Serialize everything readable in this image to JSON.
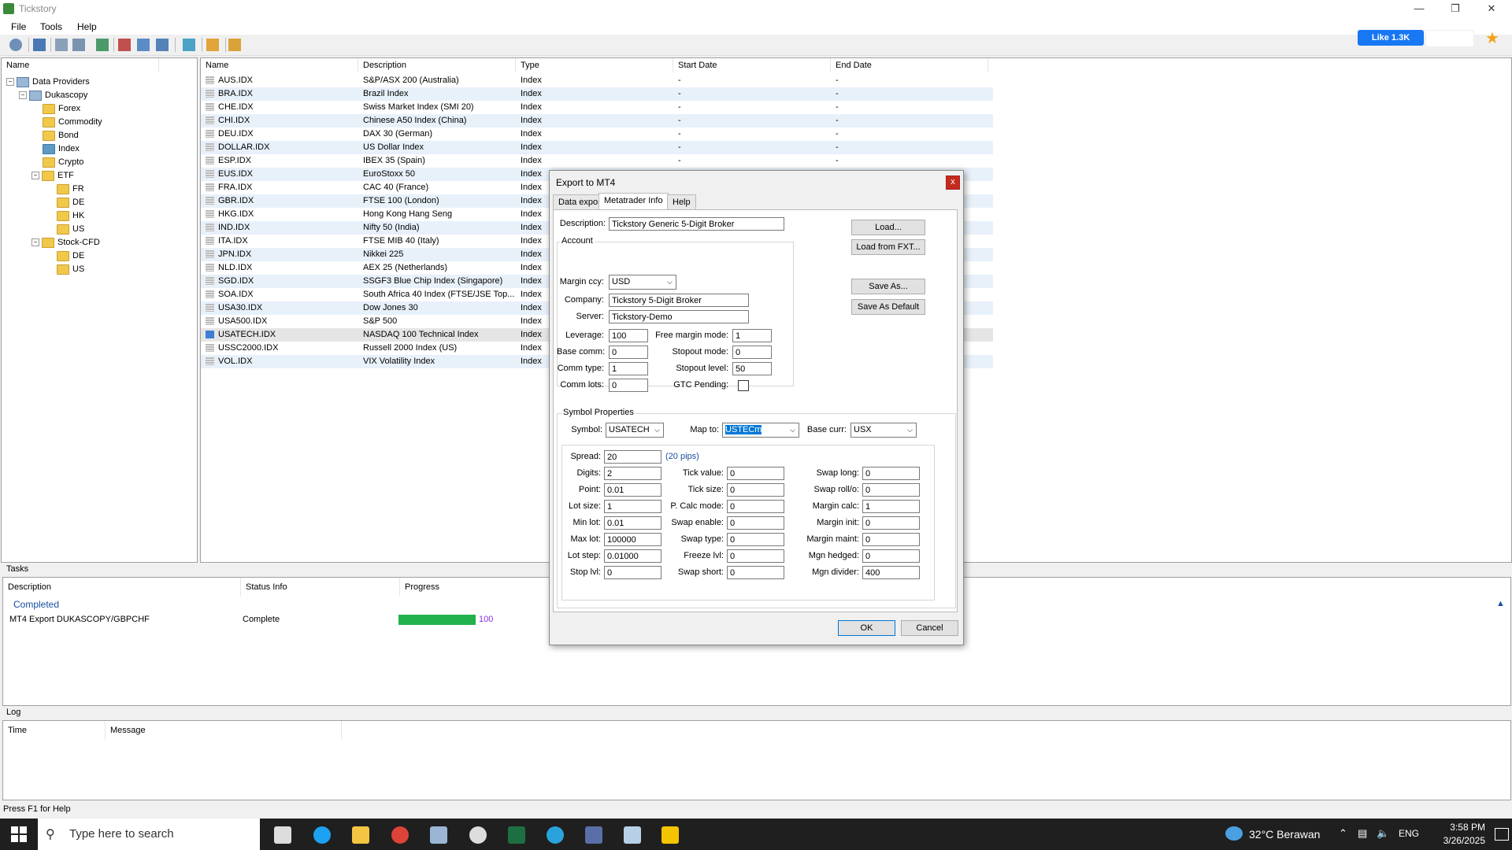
{
  "app": {
    "title": "Tickstory"
  },
  "menu": {
    "file": "File",
    "tools": "Tools",
    "help": "Help"
  },
  "social": {
    "like_label": "Like 1.3K"
  },
  "tree": {
    "header": "Name",
    "nodes": [
      {
        "label": "Data Providers",
        "level": 0
      },
      {
        "label": "Dukascopy",
        "level": 1
      },
      {
        "label": "Forex",
        "level": 2
      },
      {
        "label": "Commodity",
        "level": 2
      },
      {
        "label": "Bond",
        "level": 2
      },
      {
        "label": "Index",
        "level": 2
      },
      {
        "label": "Crypto",
        "level": 2
      },
      {
        "label": "ETF",
        "level": 2
      },
      {
        "label": "FR",
        "level": 3
      },
      {
        "label": "DE",
        "level": 3
      },
      {
        "label": "HK",
        "level": 3
      },
      {
        "label": "US",
        "level": 3
      },
      {
        "label": "Stock-CFD",
        "level": 2
      },
      {
        "label": "DE",
        "level": 3
      },
      {
        "label": "US",
        "level": 3
      }
    ]
  },
  "symbols": {
    "columns": [
      "Name",
      "Description",
      "Type",
      "Start Date",
      "End Date"
    ],
    "rows": [
      [
        "AUS.IDX",
        "S&P/ASX 200 (Australia)",
        "Index",
        "-",
        "-"
      ],
      [
        "BRA.IDX",
        "Brazil Index",
        "Index",
        "-",
        "-"
      ],
      [
        "CHE.IDX",
        "Swiss Market Index (SMI 20)",
        "Index",
        "-",
        "-"
      ],
      [
        "CHI.IDX",
        "Chinese A50 Index (China)",
        "Index",
        "-",
        "-"
      ],
      [
        "DEU.IDX",
        "DAX 30 (German)",
        "Index",
        "-",
        "-"
      ],
      [
        "DOLLAR.IDX",
        "US Dollar Index",
        "Index",
        "-",
        "-"
      ],
      [
        "ESP.IDX",
        "IBEX 35 (Spain)",
        "Index",
        "-",
        "-"
      ],
      [
        "EUS.IDX",
        "EuroStoxx 50",
        "Index",
        "",
        ""
      ],
      [
        "FRA.IDX",
        "CAC 40 (France)",
        "Index",
        "",
        ""
      ],
      [
        "GBR.IDX",
        "FTSE 100 (London)",
        "Index",
        "",
        ""
      ],
      [
        "HKG.IDX",
        "Hong Kong Hang Seng",
        "Index",
        "",
        ""
      ],
      [
        "IND.IDX",
        "Nifty 50 (India)",
        "Index",
        "",
        ""
      ],
      [
        "ITA.IDX",
        "FTSE MIB 40 (Italy)",
        "Index",
        "",
        ""
      ],
      [
        "JPN.IDX",
        "Nikkei 225",
        "Index",
        "",
        ""
      ],
      [
        "NLD.IDX",
        "AEX 25 (Netherlands)",
        "Index",
        "",
        ""
      ],
      [
        "SGD.IDX",
        "SSGF3 Blue Chip Index (Singapore)",
        "Index",
        "",
        ""
      ],
      [
        "SOA.IDX",
        "South Africa 40 Index (FTSE/JSE Top...",
        "Index",
        "",
        ""
      ],
      [
        "USA30.IDX",
        "Dow Jones 30",
        "Index",
        "",
        ""
      ],
      [
        "USA500.IDX",
        "S&P 500",
        "Index",
        "",
        ""
      ],
      [
        "USATECH.IDX",
        "NASDAQ 100 Technical Index",
        "Index",
        "",
        ""
      ],
      [
        "USSC2000.IDX",
        "Russell 2000 Index (US)",
        "Index",
        "",
        ""
      ],
      [
        "VOL.IDX",
        "VIX Volatility Index",
        "Index",
        "",
        ""
      ]
    ]
  },
  "tasks": {
    "title": "Tasks",
    "columns": [
      "Description",
      "Status Info",
      "Progress"
    ],
    "group": "Completed",
    "items": [
      {
        "description": "MT4 Export DUKASCOPY/GBPCHF",
        "status": "Complete",
        "progress": 100,
        "progress_label": "100"
      }
    ]
  },
  "log": {
    "title": "Log",
    "columns": [
      "Time",
      "Message"
    ]
  },
  "statusbar": {
    "text": "Press F1 for Help"
  },
  "dialog": {
    "title": "Export to MT4",
    "close": "x",
    "tabs": [
      "Data export",
      "Metatrader Info",
      "Help"
    ],
    "description_label": "Description:",
    "description_value": "Tickstory Generic 5-Digit Broker",
    "account": {
      "title": "Account",
      "margin_ccy_label": "Margin ccy:",
      "margin_ccy": "USD",
      "company_label": "Company:",
      "company": "Tickstory 5-Digit Broker",
      "server_label": "Server:",
      "server": "Tickstory-Demo",
      "leverage_label": "Leverage:",
      "leverage": "100",
      "base_comm_label": "Base comm:",
      "base_comm": "0",
      "comm_type_label": "Comm type:",
      "comm_type": "1",
      "comm_lots_label": "Comm lots:",
      "comm_lots": "0",
      "free_margin_label": "Free margin mode:",
      "free_margin": "1",
      "stopout_mode_label": "Stopout mode:",
      "stopout_mode": "0",
      "stopout_level_label": "Stopout level:",
      "stopout_level": "50",
      "gtc_label": "GTC Pending:"
    },
    "buttons": {
      "load": "Load...",
      "load_fxt": "Load from FXT...",
      "save_as": "Save As...",
      "save_default": "Save As Default",
      "ok": "OK",
      "cancel": "Cancel"
    },
    "symbol": {
      "title": "Symbol Properties",
      "symbol_label": "Symbol:",
      "symbol": "USATECH",
      "map_label": "Map to:",
      "map": "USTECm",
      "base_label": "Base curr:",
      "base": "USX",
      "spread_label": "Spread:",
      "spread": "20",
      "pips": "(20 pips)",
      "digits_label": "Digits:",
      "digits": "2",
      "point_label": "Point:",
      "point": "0.01",
      "lot_size_label": "Lot size:",
      "lot_size": "1",
      "min_lot_label": "Min lot:",
      "min_lot": "0.01",
      "max_lot_label": "Max lot:",
      "max_lot": "100000",
      "lot_step_label": "Lot step:",
      "lot_step": "0.01000",
      "stop_lvl_label": "Stop lvl:",
      "stop_lvl": "0",
      "tick_value_label": "Tick value:",
      "tick_value": "0",
      "tick_size_label": "Tick size:",
      "tick_size": "0",
      "p_calc_label": "P. Calc mode:",
      "p_calc": "0",
      "swap_enable_label": "Swap enable:",
      "swap_enable": "0",
      "swap_type_label": "Swap type:",
      "swap_type": "0",
      "freeze_label": "Freeze lvl:",
      "freeze": "0",
      "swap_short_label": "Swap short:",
      "swap_short": "0",
      "swap_long_label": "Swap long:",
      "swap_long": "0",
      "swap_roll_label": "Swap roll/o:",
      "swap_roll": "0",
      "margin_calc_label": "Margin calc:",
      "margin_calc": "1",
      "margin_init_label": "Margin init:",
      "margin_init": "0",
      "margin_maint_label": "Margin maint:",
      "margin_maint": "0",
      "mgn_hedged_label": "Mgn hedged:",
      "mgn_hedged": "0",
      "mgn_divider_label": "Mgn divider:",
      "mgn_divider": "400"
    }
  },
  "taskbar": {
    "search_placeholder": "Type here to search",
    "weather": "32°C Berawan",
    "lang": "ENG",
    "time": "3:58 PM",
    "date": "3/26/2025"
  }
}
